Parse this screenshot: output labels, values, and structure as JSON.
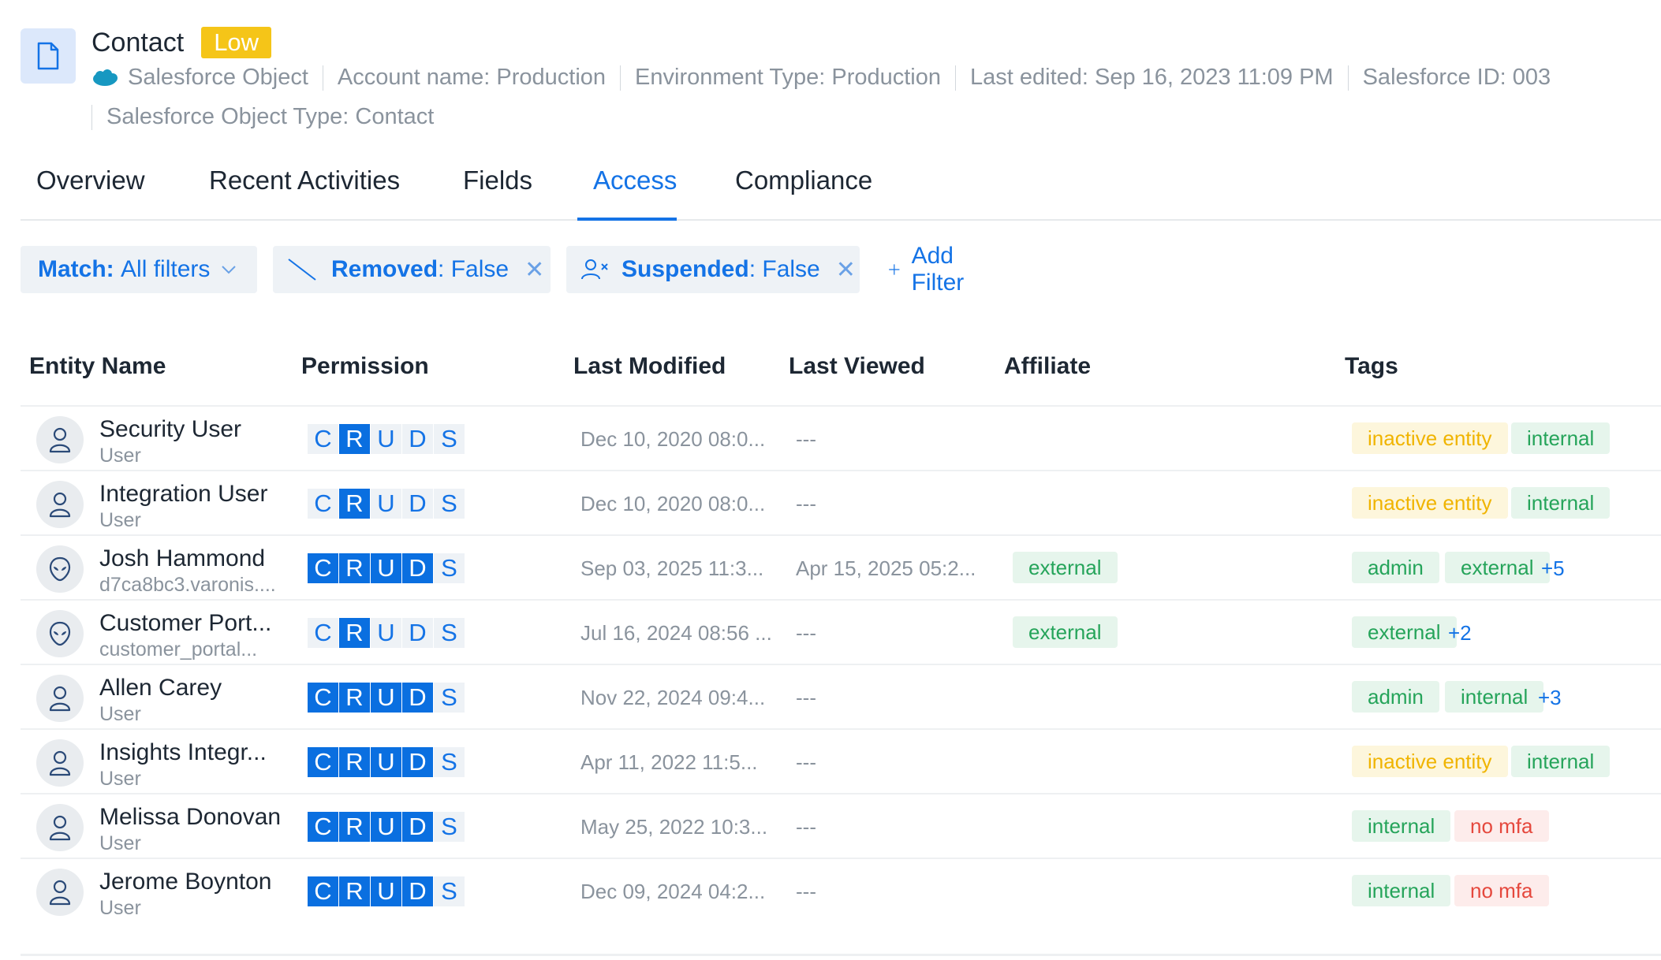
{
  "header": {
    "title": "Contact",
    "sensitivity": "Low",
    "meta": [
      "Salesforce Object",
      "Account name: Production",
      "Environment Type: Production",
      "Last edited: Sep 16, 2023 11:09 PM",
      "Salesforce ID: 003"
    ],
    "meta_line2": "Salesforce Object Type: Contact",
    "icon": "document-icon",
    "source_icon": "salesforce-cloud-icon"
  },
  "tabs": [
    {
      "label": "Overview"
    },
    {
      "label": "Recent Activities"
    },
    {
      "label": "Fields"
    },
    {
      "label": "Access",
      "active": true
    },
    {
      "label": "Compliance"
    }
  ],
  "filters": {
    "match": {
      "key": "Match:",
      "value": "All filters"
    },
    "removed": {
      "key": "Removed",
      "value": ": False"
    },
    "suspended": {
      "key": "Suspended",
      "value": ": False"
    },
    "add_label": "Add Filter"
  },
  "table": {
    "columns": [
      "Entity Name",
      "Permission",
      "Last Modified",
      "Last Viewed",
      "Affiliate",
      "Tags"
    ],
    "permission_letters": [
      "C",
      "R",
      "U",
      "D",
      "S"
    ],
    "rows": [
      {
        "name": "Security User",
        "sub": "User",
        "avatar": "user",
        "perm": [
          false,
          true,
          false,
          false,
          false
        ],
        "last_modified": "Dec 10, 2020 08:0...",
        "last_viewed": "---",
        "affiliate": "",
        "tags": [
          "inactive entity",
          "internal"
        ],
        "more": ""
      },
      {
        "name": "Integration User",
        "sub": "User",
        "avatar": "user",
        "perm": [
          false,
          true,
          false,
          false,
          false
        ],
        "last_modified": "Dec 10, 2020 08:0...",
        "last_viewed": "---",
        "affiliate": "",
        "tags": [
          "inactive entity",
          "internal"
        ],
        "more": ""
      },
      {
        "name": "Josh Hammond",
        "sub": "d7ca8bc3.varonis....",
        "avatar": "alien",
        "perm": [
          true,
          true,
          true,
          true,
          false
        ],
        "last_modified": "Sep 03, 2025 11:3...",
        "last_viewed": "Apr 15, 2025 05:2...",
        "affiliate": "external",
        "tags": [
          "admin",
          "external"
        ],
        "more": "+5"
      },
      {
        "name": "Customer Port...",
        "sub": "customer_portal...",
        "avatar": "alien",
        "perm": [
          false,
          true,
          false,
          false,
          false
        ],
        "last_modified": "Jul 16, 2024 08:56 ...",
        "last_viewed": "---",
        "affiliate": "external",
        "tags": [
          "external"
        ],
        "more": "+2"
      },
      {
        "name": "Allen Carey",
        "sub": "User",
        "avatar": "user",
        "perm": [
          true,
          true,
          true,
          true,
          false
        ],
        "last_modified": "Nov 22, 2024 09:4...",
        "last_viewed": "---",
        "affiliate": "",
        "tags": [
          "admin",
          "internal"
        ],
        "more": "+3"
      },
      {
        "name": "Insights Integr...",
        "sub": "User",
        "avatar": "user",
        "perm": [
          true,
          true,
          true,
          true,
          false
        ],
        "last_modified": "Apr 11, 2022 11:5...",
        "last_viewed": "---",
        "affiliate": "",
        "tags": [
          "inactive entity",
          "internal"
        ],
        "more": ""
      },
      {
        "name": "Melissa Donovan",
        "sub": "User",
        "avatar": "user",
        "perm": [
          true,
          true,
          true,
          true,
          false
        ],
        "last_modified": "May 25, 2022 10:3...",
        "last_viewed": "---",
        "affiliate": "",
        "tags": [
          "internal",
          "no mfa"
        ],
        "more": ""
      },
      {
        "name": "Jerome Boynton",
        "sub": "User",
        "avatar": "user",
        "perm": [
          true,
          true,
          true,
          true,
          false
        ],
        "last_modified": "Dec 09, 2024 04:2...",
        "last_viewed": "---",
        "affiliate": "",
        "tags": [
          "internal",
          "no mfa"
        ],
        "more": ""
      }
    ]
  },
  "colors": {
    "accent": "#1473e6",
    "low_badge": "#f5c518",
    "perm_on": "#0a6fe0",
    "tag_yellow": "#f0b400",
    "tag_green": "#25a45a",
    "tag_red": "#e5483d"
  }
}
